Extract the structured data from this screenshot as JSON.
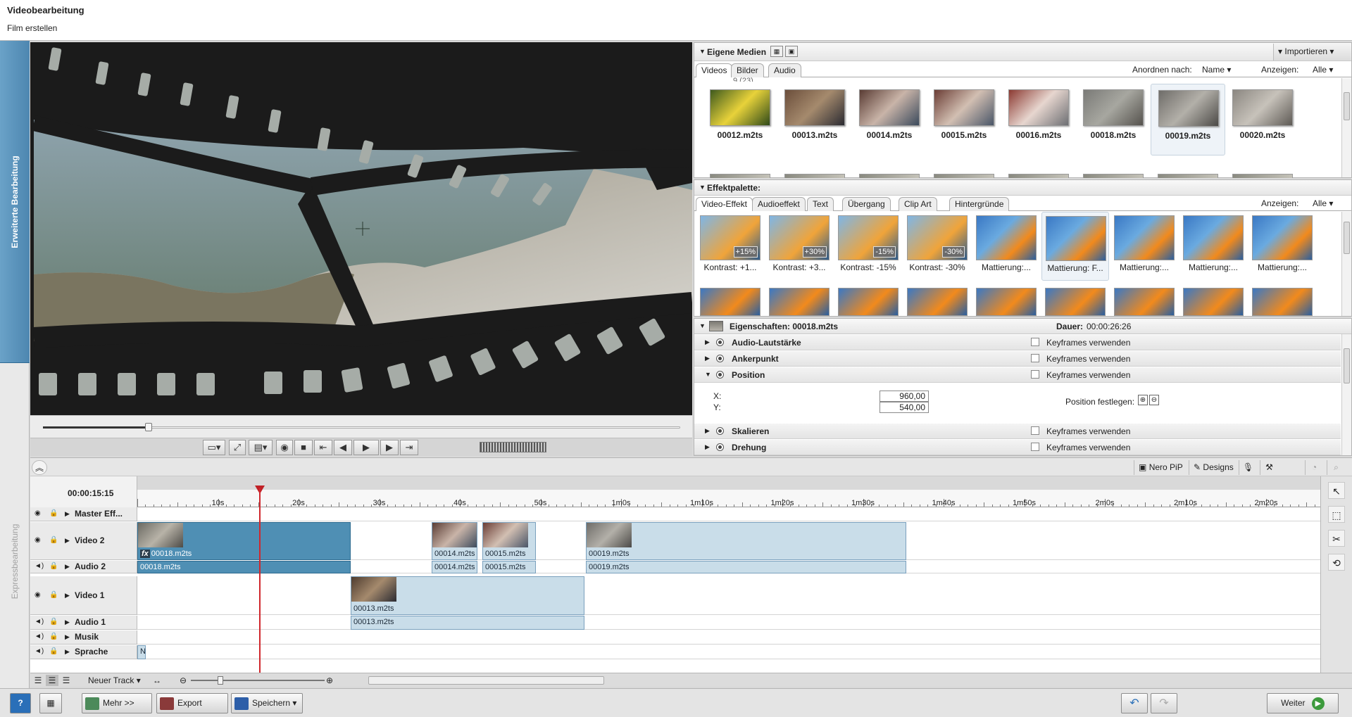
{
  "header": {
    "title": "Videobearbeitung",
    "subtitle": "Film erstellen"
  },
  "modes": {
    "advanced": "Erweiterte Bearbeitung",
    "express": "Expressbearbeitung"
  },
  "media": {
    "title": "Eigene Medien",
    "import_label": "Importieren",
    "tabs": [
      "Videos",
      "Bilder",
      "Audio"
    ],
    "sort_label": "Anordnen nach:",
    "sort_value": "Name",
    "show_label": "Anzeigen:",
    "show_value": "Alle",
    "partial_header": "9 (23)",
    "items": [
      {
        "label": "00012.m2ts",
        "colors": [
          "#3e5a1e",
          "#e8d23a",
          "#2f4a19"
        ]
      },
      {
        "label": "00013.m2ts",
        "colors": [
          "#6b4e3b",
          "#a58a6d",
          "#2b2b32"
        ]
      },
      {
        "label": "00014.m2ts",
        "colors": [
          "#5a3c34",
          "#c9b4a8",
          "#3b4a5c"
        ]
      },
      {
        "label": "00015.m2ts",
        "colors": [
          "#6b3d35",
          "#d2bfb2",
          "#4a5668"
        ]
      },
      {
        "label": "00016.m2ts",
        "colors": [
          "#8c3a32",
          "#e7d6cf",
          "#6d6f73"
        ]
      },
      {
        "label": "00018.m2ts",
        "colors": [
          "#7a7a77",
          "#a7a7a0",
          "#55524d"
        ]
      },
      {
        "label": "00019.m2ts",
        "colors": [
          "#6f6d69",
          "#b3b0a9",
          "#4c4a47"
        ],
        "selected": true
      },
      {
        "label": "00020.m2ts",
        "colors": [
          "#8b8781",
          "#c7c2ba",
          "#5e5a55"
        ]
      }
    ]
  },
  "effects": {
    "title": "Effektpalette:",
    "tabs": [
      "Video-Effekt",
      "Audioeffekt",
      "Text",
      "Übergang",
      "Clip Art",
      "Hintergründe"
    ],
    "show_label": "Anzeigen:",
    "show_value": "Alle",
    "items": [
      {
        "label": "Kontrast: +1...",
        "badge": "+15%"
      },
      {
        "label": "Kontrast: +3...",
        "badge": "+30%"
      },
      {
        "label": "Kontrast: -15%",
        "badge": "-15%"
      },
      {
        "label": "Kontrast: -30%",
        "badge": "-30%"
      },
      {
        "label": "Mattierung:...",
        "badge": ""
      },
      {
        "label": "Mattierung: F...",
        "badge": "",
        "selected": true
      },
      {
        "label": "Mattierung:...",
        "badge": ""
      },
      {
        "label": "Mattierung:...",
        "badge": ""
      },
      {
        "label": "Mattierung:...",
        "badge": ""
      }
    ]
  },
  "properties": {
    "title": "Eigenschaften: 00018.m2ts",
    "duration_label": "Dauer:",
    "duration_value": "00:00:26:26",
    "keyframes_label": "Keyframes verwenden",
    "rows": [
      "Audio-Lautstärke",
      "Ankerpunkt",
      "Position",
      "Skalieren",
      "Drehung"
    ],
    "x_label": "X:",
    "y_label": "Y:",
    "x_value": "960,00",
    "y_value": "540,00",
    "set_position_label": "Position festlegen:"
  },
  "toolbar": {
    "nero_pip": "Nero PiP",
    "designs": "Designs"
  },
  "timeline": {
    "timecode": "00:00:15:15",
    "ruler_labels": [
      "10s",
      "20s",
      "30s",
      "40s",
      "50s",
      "1m0s",
      "1m10s",
      "1m20s",
      "1m30s",
      "1m40s",
      "1m50s",
      "2m0s",
      "2m10s",
      "2m20s"
    ],
    "tracks": [
      "Master Eff...",
      "Video 2",
      "Audio 2",
      "Video 1",
      "Audio 1",
      "Musik",
      "Sprache"
    ],
    "clips": {
      "v2a": "00018.m2ts",
      "a2a": "00018.m2ts",
      "v2b": "00014.m2ts",
      "a2b": "00014.m2ts",
      "v2c": "00015.m2ts",
      "a2c": "00015.m2ts",
      "v2d": "00019.m2ts",
      "a2d": "00019.m2ts",
      "v1a": "00013.m2ts",
      "a1a": "00013.m2ts",
      "sprache": "N"
    },
    "new_track_label": "Neuer Track"
  },
  "footer": {
    "more": "Mehr >>",
    "export": "Export",
    "save": "Speichern",
    "next": "Weiter"
  },
  "colors": {
    "accent_blue": "#4d86b0",
    "playhead": "#d0272d",
    "clip_dark": "#4f8fb4",
    "clip_light": "#c9dde9"
  }
}
